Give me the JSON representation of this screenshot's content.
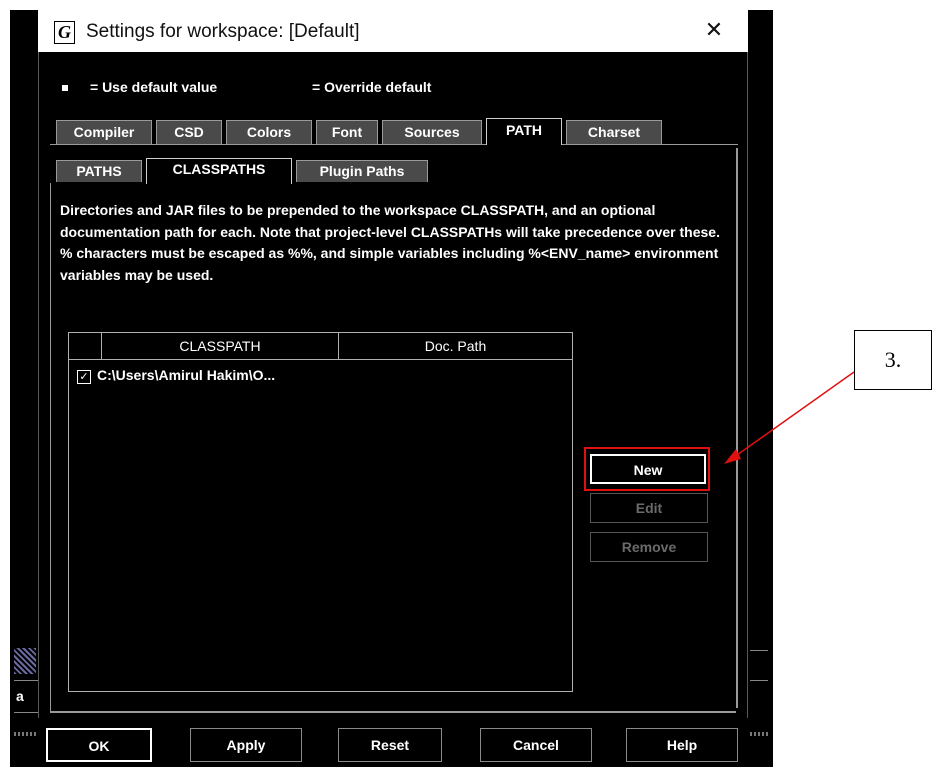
{
  "window": {
    "logo": "G",
    "title": "Settings for workspace: [Default]",
    "close_glyph": "✕"
  },
  "legend": {
    "default_label": "= Use default value",
    "override_label": "= Override default"
  },
  "main_tabs": [
    {
      "label": "Compiler",
      "selected": false
    },
    {
      "label": "CSD",
      "selected": false
    },
    {
      "label": "Colors",
      "selected": false
    },
    {
      "label": "Font",
      "selected": false
    },
    {
      "label": "Sources",
      "selected": false
    },
    {
      "label": "PATH",
      "selected": true
    },
    {
      "label": "Charset",
      "selected": false
    }
  ],
  "sub_tabs": [
    {
      "label": "PATHS",
      "selected": false
    },
    {
      "label": "CLASSPATHS",
      "selected": true
    },
    {
      "label": "Plugin Paths",
      "selected": false
    }
  ],
  "description": "Directories and JAR files to be prepended to the workspace CLASSPATH, and an optional documentation path for each. Note that project-level CLASSPATHs will take precedence over these. % characters must be escaped as %%, and simple variables including %<ENV_name> environment variables may be used.",
  "table": {
    "columns": [
      "",
      "CLASSPATH",
      "Doc. Path"
    ],
    "rows": [
      {
        "checked": true,
        "check_glyph": "✓",
        "classpath": "C:\\Users\\Amirul Hakim\\O...",
        "doc_path": ""
      }
    ]
  },
  "side_buttons": {
    "new": "New",
    "edit": "Edit",
    "remove": "Remove"
  },
  "bottom_buttons": {
    "ok": "OK",
    "apply": "Apply",
    "reset": "Reset",
    "cancel": "Cancel",
    "help": "Help"
  },
  "annotation": {
    "callout_label": "3.",
    "highlight_color": "#e01010"
  },
  "background_fragment": {
    "text": "a"
  }
}
